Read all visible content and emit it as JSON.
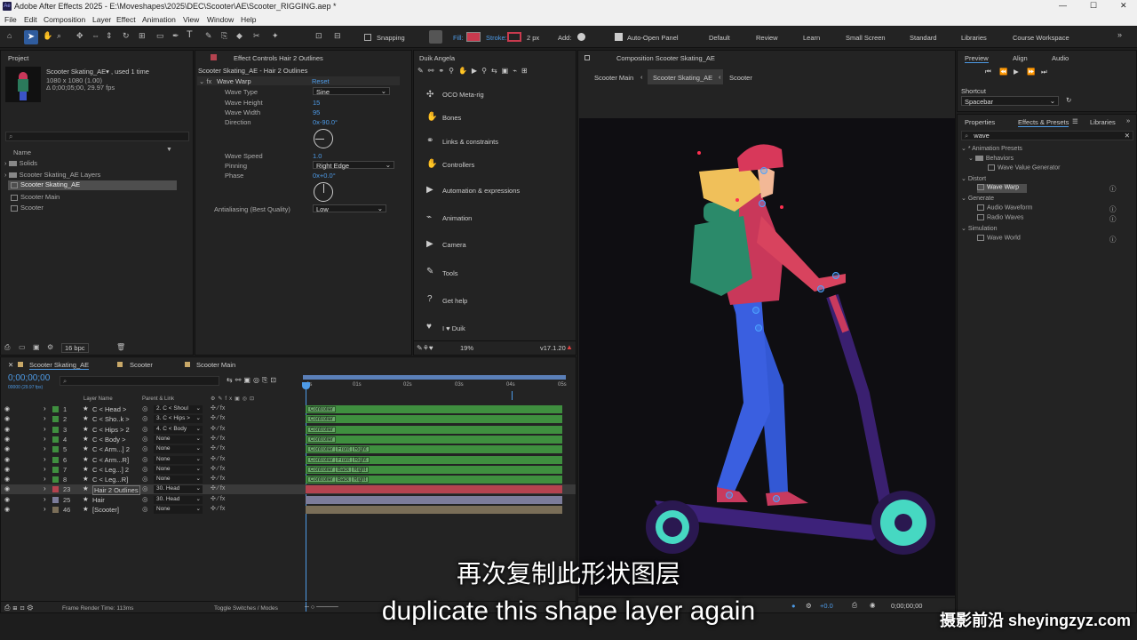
{
  "window": {
    "title": "Adobe After Effects 2025 - E:\\Moveshapes\\2025\\DEC\\Scooter\\AE\\Scooter_RIGGING.aep *",
    "ctrl_min": "—",
    "ctrl_max": "☐",
    "ctrl_close": "✕"
  },
  "menu": [
    "File",
    "Edit",
    "Composition",
    "Layer",
    "Effect",
    "Animation",
    "View",
    "Window",
    "Help"
  ],
  "toolbar": {
    "snapping": "Snapping",
    "fill": "Fill:",
    "stroke": "Stroke:",
    "stroke_width": "2 px",
    "add": "Add:",
    "auto_open": "Auto-Open Panel",
    "workspaces": [
      "Default",
      "Review",
      "Learn",
      "Small Screen",
      "Standard",
      "Libraries",
      "Course Workspace"
    ]
  },
  "project": {
    "tab": "Project",
    "comp_name": "Scooter Skating_AE▾ , used 1 time",
    "dims": "1080 x 1080 (1.00)",
    "duration": "Δ 0;00;05;00, 29.97 fps",
    "search_placeholder": "⌕",
    "col_name": "Name",
    "bpc": "16 bpc",
    "items": [
      {
        "label": "Solids",
        "kind": "folder"
      },
      {
        "label": "Scooter Skating_AE Layers",
        "kind": "folder"
      },
      {
        "label": "Scooter Skating_AE",
        "kind": "comp",
        "selected": true
      },
      {
        "label": "Scooter Main",
        "kind": "comp"
      },
      {
        "label": "Scooter",
        "kind": "comp"
      }
    ]
  },
  "effects": {
    "tab": "Effect Controls Hair 2 Outlines",
    "subtitle": "Scooter Skating_AE - Hair 2 Outlines",
    "effect_name": "Wave Warp",
    "reset": "Reset",
    "props": [
      {
        "label": "Wave Type",
        "value": "Sine",
        "kind": "dropdown"
      },
      {
        "label": "Wave Height",
        "value": "15",
        "kind": "num"
      },
      {
        "label": "Wave Width",
        "value": "95",
        "kind": "num"
      },
      {
        "label": "Direction",
        "value": "0x-90.0°",
        "kind": "num"
      },
      {
        "label": "Wave Speed",
        "value": "1.0",
        "kind": "num"
      },
      {
        "label": "Pinning",
        "value": "Right Edge",
        "kind": "dropdown"
      },
      {
        "label": "Phase",
        "value": "0x+0.0°",
        "kind": "num"
      },
      {
        "label": "Antialiasing (Best Quality)",
        "value": "Low",
        "kind": "dropdown"
      }
    ]
  },
  "duik": {
    "tab": "Duik Angela",
    "items": [
      "OCO Meta-rig",
      "Bones",
      "Links & constraints",
      "Controllers",
      "Automation & expressions",
      "Animation",
      "Camera",
      "Tools",
      "Get help",
      "I ♥ Duik"
    ],
    "zoom": "19%",
    "version": "v17.1.20"
  },
  "comp": {
    "tab": "Composition Scooter Skating_AE",
    "crumbs": [
      "Scooter Main",
      "Scooter Skating_AE",
      "Scooter"
    ],
    "timecode": "0;00;00;00",
    "zoom": "+0.0"
  },
  "preview": {
    "tabs": [
      "Preview",
      "Align",
      "Audio"
    ],
    "shortcut_label": "Shortcut",
    "shortcut_value": "Spacebar"
  },
  "efx_presets": {
    "tabs": [
      "Properties",
      "Effects & Presets",
      "Libraries"
    ],
    "search": "wave",
    "tree": [
      {
        "label": "* Animation Presets",
        "level": 0
      },
      {
        "label": "Behaviors",
        "level": 1
      },
      {
        "label": "Wave Value Generator",
        "level": 2
      },
      {
        "label": "Distort",
        "level": 0
      },
      {
        "label": "Wave Warp",
        "level": 1,
        "selected": true
      },
      {
        "label": "Generate",
        "level": 0
      },
      {
        "label": "Audio Waveform",
        "level": 1
      },
      {
        "label": "Radio Waves",
        "level": 1
      },
      {
        "label": "Simulation",
        "level": 0
      },
      {
        "label": "Wave World",
        "level": 1
      }
    ]
  },
  "timeline": {
    "tabs": [
      "Scooter Skating_AE",
      "Scooter",
      "Scooter Main"
    ],
    "timecode": "0;00;00;00",
    "fps": "00000 (29.97 fps)",
    "col_layer": "Layer Name",
    "col_parent": "Parent & Link",
    "ruler": [
      "0s",
      "01s",
      "02s",
      "03s",
      "04s",
      "05s"
    ],
    "layers": [
      {
        "num": "1",
        "name": "C < Head >",
        "parent": "2. C < Shoul",
        "bar": "Controller",
        "color": "#3f8f3f"
      },
      {
        "num": "2",
        "name": "C < Sho..k >",
        "parent": "3. C < Hips >",
        "bar": "Controller",
        "color": "#3f8f3f"
      },
      {
        "num": "3",
        "name": "C < Hips > 2",
        "parent": "4. C < Body",
        "bar": "Controller",
        "color": "#3f8f3f"
      },
      {
        "num": "4",
        "name": "C < Body >",
        "parent": "None",
        "bar": "Controller",
        "color": "#3f8f3f"
      },
      {
        "num": "5",
        "name": "C < Arm...] 2",
        "parent": "None",
        "bar": "Controller | Front | Right",
        "color": "#3f8f3f"
      },
      {
        "num": "6",
        "name": "C < Arm...R]",
        "parent": "None",
        "bar": "Controller | Front | Right",
        "color": "#3f8f3f"
      },
      {
        "num": "7",
        "name": "C < Leg...] 2",
        "parent": "None",
        "bar": "Controller | Back | Right",
        "color": "#3f8f3f"
      },
      {
        "num": "8",
        "name": "C < Leg...R]",
        "parent": "None",
        "bar": "Controller | Back | Right",
        "color": "#3f8f3f"
      },
      {
        "num": "23",
        "name": "Hair 2 Outlines",
        "parent": "30. Head",
        "bar": "",
        "color": "#b4434f",
        "selected": true
      },
      {
        "num": "25",
        "name": "Hair",
        "parent": "30. Head",
        "bar": "",
        "color": "#7c7c9a"
      },
      {
        "num": "46",
        "name": "[Scooter]",
        "parent": "None",
        "bar": "",
        "color": "#7a6e58"
      }
    ],
    "footer_render": "Frame Render Time: 113ms",
    "footer_toggle": "Toggle Switches / Modes"
  },
  "subtitles": {
    "zh": "再次复制此形状图层",
    "en": "duplicate this shape layer again"
  },
  "watermark": "摄影前沿 sheyingzyz.com"
}
